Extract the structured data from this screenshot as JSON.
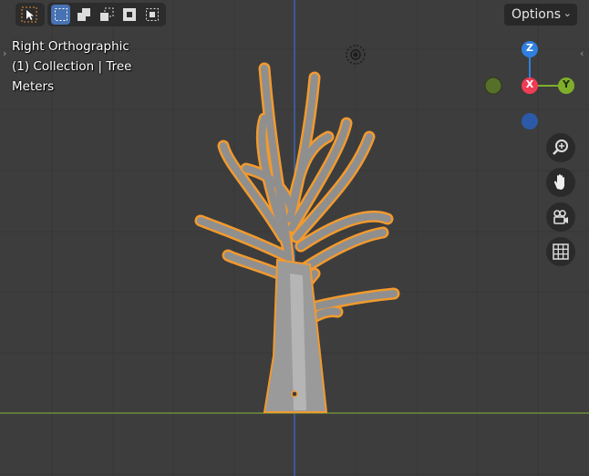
{
  "colors": {
    "background": "#3d3d3d",
    "grid": "#353535",
    "axis_z": "#3f6fd0",
    "axis_y": "#7a9a3a",
    "selection": "#f29a2e",
    "mesh": "#8f8f8f",
    "gizmo_x": "#f03b55",
    "gizmo_y": "#7fae2b",
    "gizmo_z": "#2f7fde"
  },
  "toolbar": {
    "select_tool_icon": "cursor-select-icon",
    "mode_icons": [
      "select-new-icon",
      "select-extend-icon",
      "select-subtract-icon",
      "select-difference-icon",
      "select-intersect-icon"
    ]
  },
  "options": {
    "label": "Options"
  },
  "overlay": {
    "view_name": "Right Orthographic",
    "collection_info": "(1) Collection | Tree",
    "units": "Meters"
  },
  "gizmo": {
    "z_label": "Z",
    "x_label": "X",
    "y_label": "Y"
  },
  "nav_buttons": [
    "zoom-icon",
    "pan-hand-icon",
    "camera-view-icon",
    "ortho-grid-icon"
  ]
}
